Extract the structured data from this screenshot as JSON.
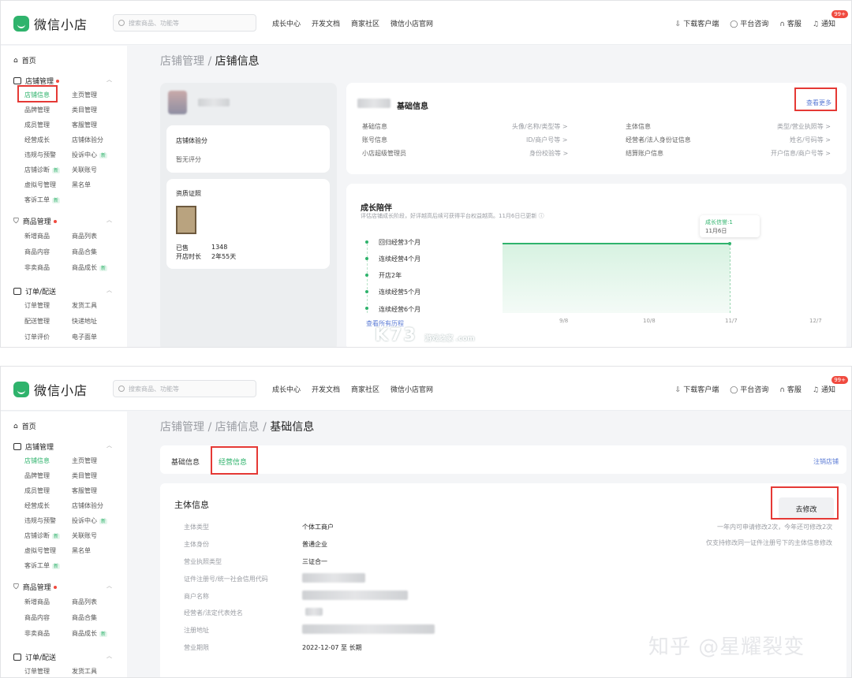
{
  "header": {
    "logo": "微信小店",
    "search_placeholder": "搜索商品、功能等",
    "nav": [
      "成长中心",
      "开发文档",
      "商家社区",
      "微信小店官网"
    ],
    "right": [
      "下载客户端",
      "平台咨询",
      "客服",
      "通知"
    ],
    "badge": "99+"
  },
  "sidebar": {
    "home": "首页",
    "store_section": "店铺管理",
    "store_items": [
      [
        "店铺信息",
        "主页管理"
      ],
      [
        "品牌管理",
        "类目管理"
      ],
      [
        "成员管理",
        "客服管理"
      ],
      [
        "经营成长",
        "店铺体验分"
      ],
      [
        "违规与预警",
        "投诉中心"
      ],
      [
        "店铺诊断",
        "关联账号"
      ],
      [
        "虚拟号管理",
        "黑名单"
      ],
      [
        "客诉工单",
        ""
      ]
    ],
    "goods_section": "商品管理",
    "goods_items": [
      [
        "新增商品",
        "商品列表"
      ],
      [
        "商品内容",
        "商品合集"
      ],
      [
        "非卖商品",
        "商品成长"
      ]
    ],
    "order_section": "订单/配送",
    "order_items": [
      [
        "订单管理",
        "发货工具"
      ],
      [
        "配送管理",
        "快递地址"
      ],
      [
        "订单评价",
        "电子面单"
      ]
    ],
    "new_tag": "新"
  },
  "s1": {
    "crumb_prev": "店铺管理 / ",
    "crumb_cur": "店铺信息",
    "score_title": "店铺体验分",
    "score_value": "暂无评分",
    "cert_title": "资质证照",
    "sold_label": "已售",
    "sold_value": "1348",
    "age_label": "开店时长",
    "age_value": "2年55天",
    "basic_title": "基础信息",
    "view_more": "查看更多",
    "basic_rows": [
      [
        "基础信息",
        "头像/名称/类型等 >",
        "主体信息",
        "类型/营业执照等 >"
      ],
      [
        "账号信息",
        "ID/商户号等 >",
        "经营者/法人身份证信息",
        "姓名/号码等 >"
      ],
      [
        "小店超级管理员",
        "身份校验等 >",
        "结算账户信息",
        "开户信息/商户号等 >"
      ]
    ],
    "growth_title": "成长陪伴",
    "growth_sub": "评估店铺成长阶段，好评越高后续可获得平台权益越高。11月6日已更新 ⓘ",
    "timeline": [
      "回归经营3个月",
      "连续经营4个月",
      "开店2年",
      "连续经营5个月",
      "连续经营6个月"
    ],
    "history_link": "查看所有历程",
    "tooltip_title": "成长信誉:1",
    "tooltip_date": "11月6日",
    "x_ticks": [
      "9/8",
      "10/8",
      "11/7",
      "12/7"
    ]
  },
  "s2": {
    "crumb_prev": "店铺管理 / 店铺信息 / ",
    "crumb_cur": "基础信息",
    "tabs": [
      "基础信息",
      "经营信息"
    ],
    "cancel_store": "注销店铺",
    "section_title": "主体信息",
    "edit_button": "去修改",
    "note1": "一年内可申请修改2次，今年还可修改2次",
    "note2": "仅支持修改同一证件注册号下的主体信息修改",
    "rows": [
      [
        "主体类型",
        "个体工商户"
      ],
      [
        "主体身份",
        "普通企业"
      ],
      [
        "营业执照类型",
        "三证合一"
      ],
      [
        "证件注册号/统一社会信用代码",
        ""
      ],
      [
        "商户名称",
        ""
      ],
      [
        "经营者/法定代表姓名",
        ""
      ],
      [
        "注册地址",
        ""
      ],
      [
        "营业期限",
        "2022-12-07 至 长期"
      ]
    ]
  },
  "watermarks": {
    "k73": "K73",
    "k73_sub": "游戏之家 .com",
    "zhihu": "知乎 @星耀裂变"
  },
  "colors": {
    "accent": "#2fb36c",
    "highlight": "#e53935",
    "link": "#5b7bd5"
  }
}
